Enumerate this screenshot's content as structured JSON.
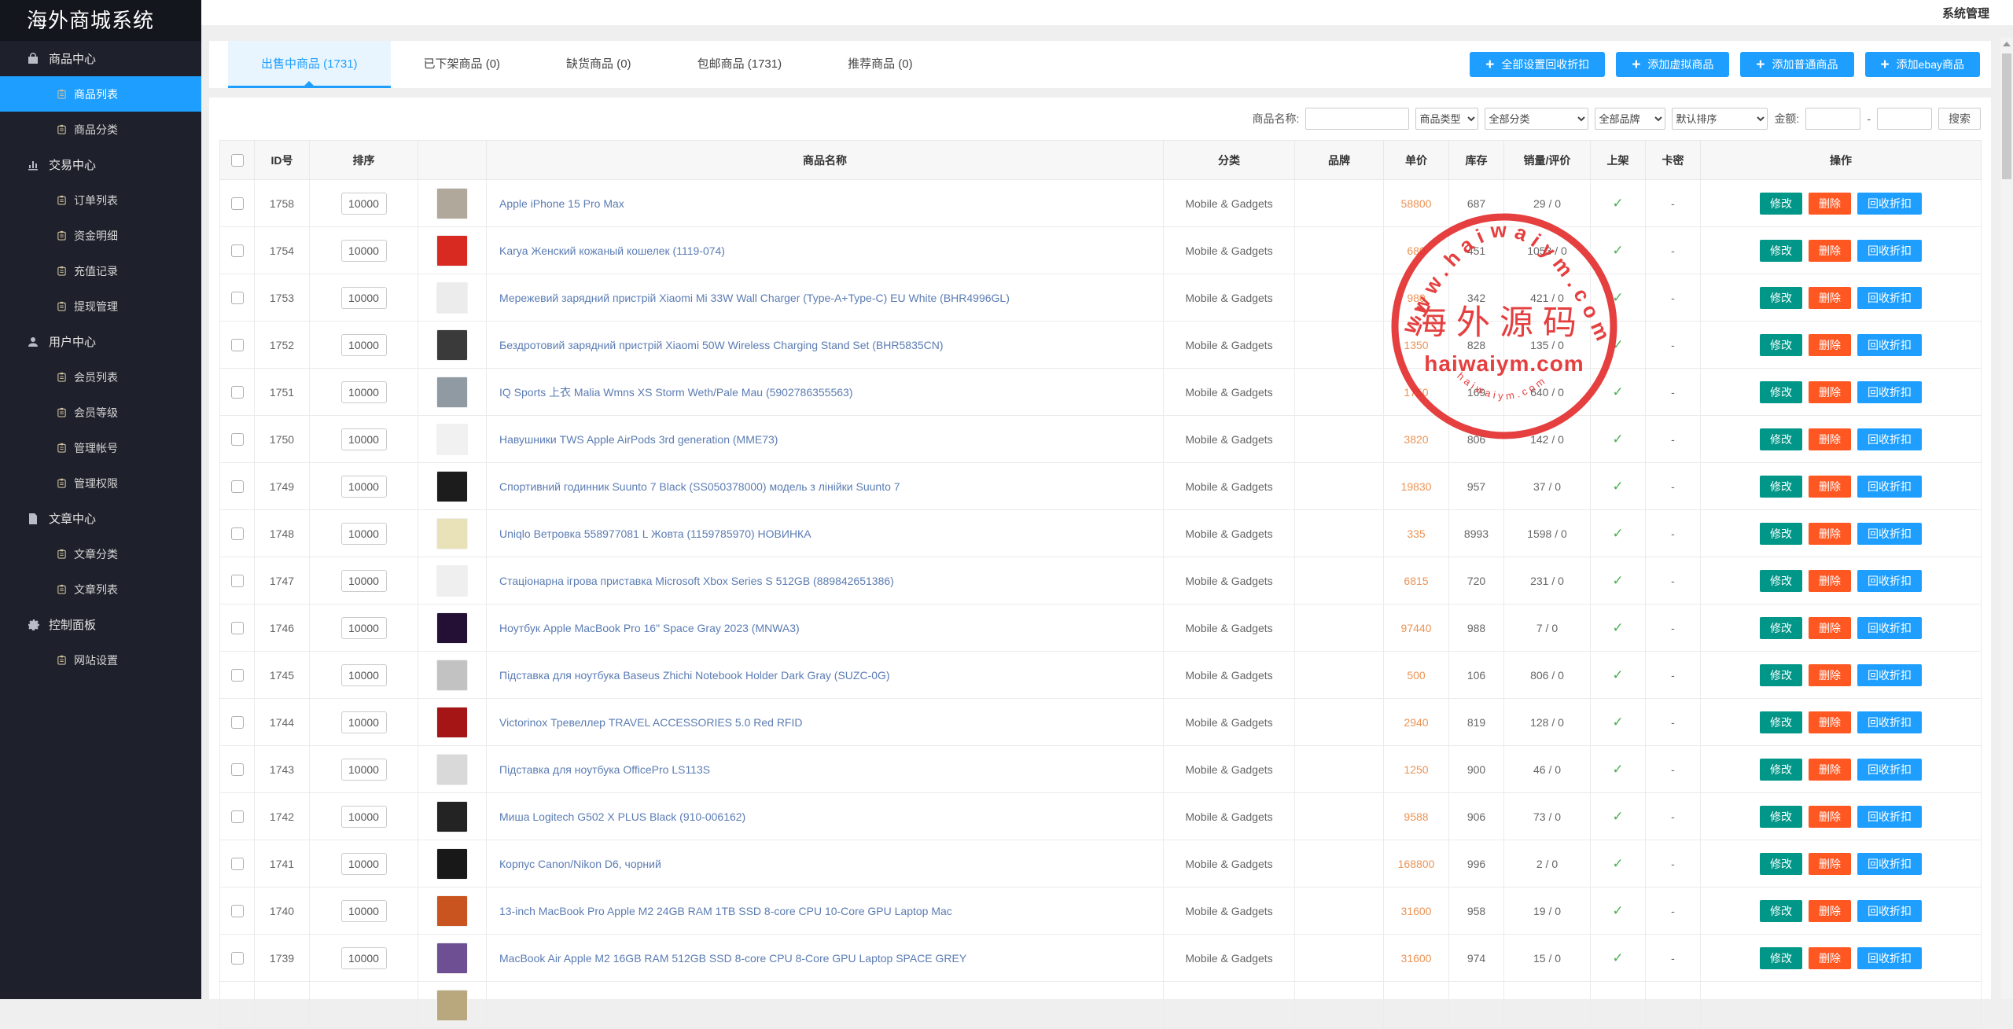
{
  "app": {
    "title": "海外商城系统"
  },
  "topbar": {
    "menu": "系统管理"
  },
  "sidebar": {
    "sections": [
      {
        "label": "商品中心",
        "icon": "bag",
        "key": "product-center",
        "items": [
          {
            "label": "商品列表",
            "key": "product-list",
            "active": true
          },
          {
            "label": "商品分类",
            "key": "product-category"
          }
        ]
      },
      {
        "label": "交易中心",
        "icon": "chart",
        "key": "trade-center",
        "items": [
          {
            "label": "订单列表",
            "key": "order-list"
          },
          {
            "label": "资金明细",
            "key": "fund-details"
          },
          {
            "label": "充值记录",
            "key": "recharge-records"
          },
          {
            "label": "提现管理",
            "key": "withdrawal-management"
          }
        ]
      },
      {
        "label": "用户中心",
        "icon": "user",
        "key": "user-center",
        "items": [
          {
            "label": "会员列表",
            "key": "member-list"
          },
          {
            "label": "会员等级",
            "key": "member-level"
          },
          {
            "label": "管理帐号",
            "key": "admin-account"
          },
          {
            "label": "管理权限",
            "key": "admin-permission"
          }
        ]
      },
      {
        "label": "文章中心",
        "icon": "doc",
        "key": "article-center",
        "items": [
          {
            "label": "文章分类",
            "key": "article-category"
          },
          {
            "label": "文章列表",
            "key": "article-list"
          }
        ]
      },
      {
        "label": "控制面板",
        "icon": "gear",
        "key": "control-panel",
        "items": [
          {
            "label": "网站设置",
            "key": "site-settings"
          }
        ]
      }
    ]
  },
  "tabs": [
    {
      "label": "出售中商品 (1731)",
      "key": "tab-onsale",
      "active": true
    },
    {
      "label": "已下架商品 (0)",
      "key": "tab-offshelf"
    },
    {
      "label": "缺货商品 (0)",
      "key": "tab-outofstock"
    },
    {
      "label": "包邮商品 (1731)",
      "key": "tab-freeshipping"
    },
    {
      "label": "推荐商品 (0)",
      "key": "tab-recommended"
    }
  ],
  "header_actions": [
    {
      "label": "全部设置回收折扣",
      "key": "set-all-recycle-discount-button"
    },
    {
      "label": "添加虚拟商品",
      "key": "add-virtual-product-button"
    },
    {
      "label": "添加普通商品",
      "key": "add-normal-product-button"
    },
    {
      "label": "添加ebay商品",
      "key": "add-ebay-product-button"
    }
  ],
  "filters": {
    "name_label": "商品名称:",
    "type_select": "商品类型",
    "category_select": "全部分类",
    "brand_select": "全部品牌",
    "sort_select": "默认排序",
    "amount_label": "金额:",
    "amount_separator": "-",
    "search_label": "搜索"
  },
  "watermark": {
    "top_text": "www.haiwaiym.com",
    "center_text": "海外源码",
    "mid_text": "haiwaiym.com",
    "bottom_text": "haiwaiym.com",
    "color": "#e32b2b"
  },
  "table": {
    "headers": [
      "",
      "ID号",
      "排序",
      "",
      "商品名称",
      "分类",
      "品牌",
      "单价",
      "库存",
      "销量/评价",
      "上架",
      "卡密",
      "操作"
    ],
    "action_labels": [
      "修改",
      "删除",
      "回收折扣"
    ],
    "rows": [
      {
        "id": "1758",
        "sort": "10000",
        "name": "Apple iPhone 15 Pro Max",
        "category": "Mobile & Gadgets",
        "brand": "",
        "price": "58800",
        "stock": "687",
        "sales": "29 / 0",
        "listed": true,
        "card": "-",
        "thumb": "#b0a89a"
      },
      {
        "id": "1754",
        "sort": "10000",
        "name": "Karya Женский кожаный кошелек (1119-074)",
        "category": "Mobile & Gadgets",
        "brand": "",
        "price": "680",
        "stock": "451",
        "sales": "1053 / 0",
        "listed": true,
        "card": "-",
        "thumb": "#d92a22"
      },
      {
        "id": "1753",
        "sort": "10000",
        "name": "Мережевий зарядний пристрій Xiaomi Mi 33W Wall Charger (Type-A+Type-C) EU White (BHR4996GL)",
        "category": "Mobile & Gadgets",
        "brand": "",
        "price": "980",
        "stock": "342",
        "sales": "421 / 0",
        "listed": true,
        "card": "-",
        "thumb": "#ececec"
      },
      {
        "id": "1752",
        "sort": "10000",
        "name": "Бездротовий зарядний пристрій Xiaomi 50W Wireless Charging Stand Set (BHR5835CN)",
        "category": "Mobile & Gadgets",
        "brand": "",
        "price": "1350",
        "stock": "828",
        "sales": "135 / 0",
        "listed": true,
        "card": "-",
        "thumb": "#3a3a3a"
      },
      {
        "id": "1751",
        "sort": "10000",
        "name": "IQ Sports 上衣 Malia Wmns XS Storm Weth/Pale Mau (5902786355563)",
        "category": "Mobile & Gadgets",
        "brand": "",
        "price": "1750",
        "stock": "169",
        "sales": "640 / 0",
        "listed": true,
        "card": "-",
        "thumb": "#8f9aa3"
      },
      {
        "id": "1750",
        "sort": "10000",
        "name": "Навушники TWS Apple AirPods 3rd generation (MME73)",
        "category": "Mobile & Gadgets",
        "brand": "",
        "price": "3820",
        "stock": "806",
        "sales": "142 / 0",
        "listed": true,
        "card": "-",
        "thumb": "#f1f1f1"
      },
      {
        "id": "1749",
        "sort": "10000",
        "name": "Спортивний годинник Suunto 7 Black (SS050378000) модель з лінійки Suunto 7",
        "category": "Mobile & Gadgets",
        "brand": "",
        "price": "19830",
        "stock": "957",
        "sales": "37 / 0",
        "listed": true,
        "card": "-",
        "thumb": "#1c1c1c"
      },
      {
        "id": "1748",
        "sort": "10000",
        "name": "Uniqlo Ветровка 558977081 L Жовта (1159785970) НОВИНКА",
        "category": "Mobile & Gadgets",
        "brand": "",
        "price": "335",
        "stock": "8993",
        "sales": "1598 / 0",
        "listed": true,
        "card": "-",
        "thumb": "#e9e2b8"
      },
      {
        "id": "1747",
        "sort": "10000",
        "name": "Стаціонарна ігрова приставка Microsoft Xbox Series S 512GB (889842651386)",
        "category": "Mobile & Gadgets",
        "brand": "",
        "price": "6815",
        "stock": "720",
        "sales": "231 / 0",
        "listed": true,
        "card": "-",
        "thumb": "#efefef"
      },
      {
        "id": "1746",
        "sort": "10000",
        "name": "Ноутбук Apple MacBook Pro 16\" Space Gray 2023 (MNWA3)",
        "category": "Mobile & Gadgets",
        "brand": "",
        "price": "97440",
        "stock": "988",
        "sales": "7 / 0",
        "listed": true,
        "card": "-",
        "thumb": "#241034"
      },
      {
        "id": "1745",
        "sort": "10000",
        "name": "Підставка для ноутбука Baseus Zhichi Notebook Holder Dark Gray (SUZC-0G)",
        "category": "Mobile & Gadgets",
        "brand": "",
        "price": "500",
        "stock": "106",
        "sales": "806 / 0",
        "listed": true,
        "card": "-",
        "thumb": "#c2c2c2"
      },
      {
        "id": "1744",
        "sort": "10000",
        "name": "Victorinox Тревеллер TRAVEL ACCESSORIES 5.0 Red RFID",
        "category": "Mobile & Gadgets",
        "brand": "",
        "price": "2940",
        "stock": "819",
        "sales": "128 / 0",
        "listed": true,
        "card": "-",
        "thumb": "#a61515"
      },
      {
        "id": "1743",
        "sort": "10000",
        "name": "Підставка для ноутбука OfficePro LS113S",
        "category": "Mobile & Gadgets",
        "brand": "",
        "price": "1250",
        "stock": "900",
        "sales": "46 / 0",
        "listed": true,
        "card": "-",
        "thumb": "#d9d9d9"
      },
      {
        "id": "1742",
        "sort": "10000",
        "name": "Миша Logitech G502 X PLUS Black (910-006162)",
        "category": "Mobile & Gadgets",
        "brand": "",
        "price": "9588",
        "stock": "906",
        "sales": "73 / 0",
        "listed": true,
        "card": "-",
        "thumb": "#232323"
      },
      {
        "id": "1741",
        "sort": "10000",
        "name": "Корпус Canon/Nikon D6, чорний",
        "category": "Mobile & Gadgets",
        "brand": "",
        "price": "168800",
        "stock": "996",
        "sales": "2 / 0",
        "listed": true,
        "card": "-",
        "thumb": "#181818"
      },
      {
        "id": "1740",
        "sort": "10000",
        "name": "13-inch MacBook Pro Apple M2 24GB RAM 1TB SSD 8-core CPU 10-Core GPU Laptop Mac",
        "category": "Mobile & Gadgets",
        "brand": "",
        "price": "31600",
        "stock": "958",
        "sales": "19 / 0",
        "listed": true,
        "card": "-",
        "thumb": "#c9541f"
      },
      {
        "id": "1739",
        "sort": "10000",
        "name": "MacBook Air Apple M2 16GB RAM 512GB SSD 8-core CPU 8-Core GPU Laptop SPACE GREY",
        "category": "Mobile & Gadgets",
        "brand": "",
        "price": "31600",
        "stock": "974",
        "sales": "15 / 0",
        "listed": true,
        "card": "-",
        "thumb": "#6e4f93"
      }
    ],
    "partial_row": {
      "thumb": "#b9a77e"
    }
  },
  "colors": {
    "primary_blue": "#1e9fff",
    "edit_green": "#009688",
    "delete_red": "#ff5722",
    "price_orange": "#ec9355",
    "link_blue": "#5b7cb3",
    "check_green": "#4cb050",
    "stamp_red": "#e32b2b",
    "sidebar_bg": "#1e212b"
  }
}
